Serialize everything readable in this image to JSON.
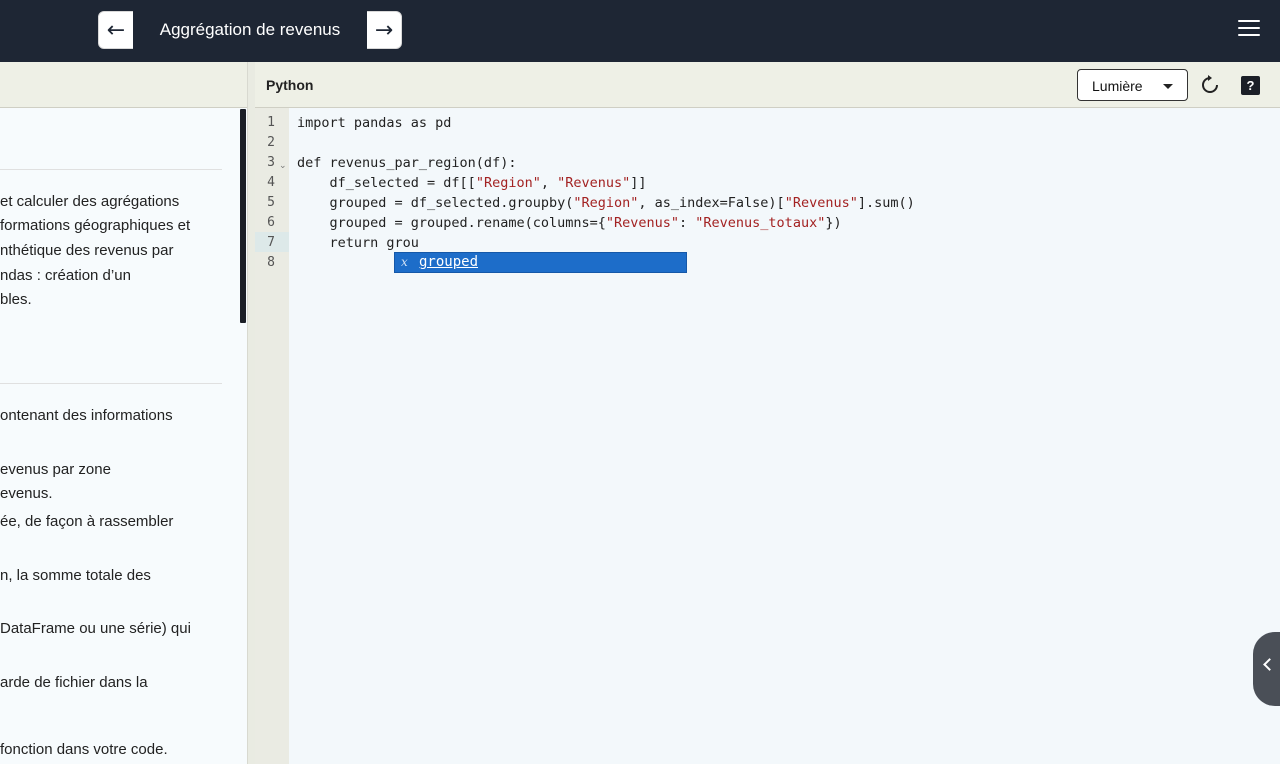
{
  "header": {
    "title": "Aggrégation de revenus",
    "prev_icon": "arrow-left-icon",
    "next_icon": "arrow-right-icon",
    "menu_icon": "hamburger-menu-icon"
  },
  "instructions": {
    "lines": [
      "et calculer des agrégations",
      "formations géographiques et",
      "nthétique des revenus par",
      "ndas : création d’un",
      "bles.",
      "ontenant des informations",
      "evenus par zone",
      "evenus.",
      "ée, de façon à rassembler",
      "n, la somme totale des",
      "DataFrame ou une série) qui",
      "arde de fichier dans la",
      "fonction dans votre code."
    ]
  },
  "editor": {
    "language": "Python",
    "theme": "Lumière",
    "reset_icon": "reset-icon",
    "help_label": "?",
    "line_numbers": [
      "1",
      "2",
      "3",
      "4",
      "5",
      "6",
      "7",
      "8"
    ],
    "code": {
      "l1": "import pandas as pd",
      "l3": "def revenus_par_region(df):",
      "l4a": "    df_selected = df[[",
      "l4s1": "\"Region\"",
      "l4b": ", ",
      "l4s2": "\"Revenus\"",
      "l4c": "]]",
      "l5a": "    grouped = df_selected.groupby(",
      "l5s1": "\"Region\"",
      "l5b": ", as_index=False)[",
      "l5s2": "\"Revenus\"",
      "l5c": "].sum()",
      "l6a": "    grouped = grouped.rename(columns={",
      "l6s1": "\"Revenus\"",
      "l6b": ": ",
      "l6s2": "\"Revenus_totaux\"",
      "l6c": "})",
      "l7": "    return grou"
    },
    "autocomplete": {
      "type_glyph": "x",
      "suggestion": "grouped"
    }
  },
  "colors": {
    "topbar": "#1e2634",
    "string": "#a32222",
    "autocomplete_bg": "#1d6dc9"
  }
}
